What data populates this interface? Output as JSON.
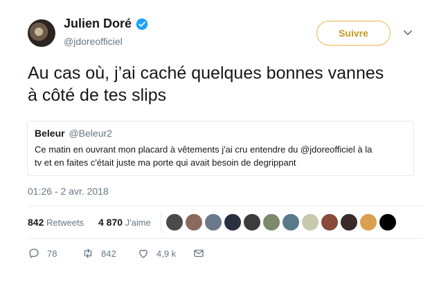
{
  "author": {
    "name": "Julien Doré",
    "handle": "@jdoreofficiel",
    "verified": true
  },
  "follow_button": {
    "label": "Suivre"
  },
  "tweet": {
    "line1": "Au cas où, j’ai caché quelques bonnes vannes",
    "line2": "à côté de tes slips"
  },
  "quoted": {
    "name": "Beleur",
    "handle": "@Beleur2",
    "line1": "Ce matin en ouvrant mon placard à vêtements j'ai cru entendre du @jdoreofficiel à la",
    "line2": "tv et en faites c'était juste ma porte qui avait besoin de degrippant"
  },
  "timestamp": "01:26 - 2 avr. 2018",
  "stats": {
    "retweets_count": "842",
    "retweets_label": "Retweets",
    "likes_count": "4 870",
    "likes_label": "J'aime"
  },
  "likers_colors": [
    "#4a4a4a",
    "#8a6a5a",
    "#6a7a8a",
    "#2a3040",
    "#3c3c3c",
    "#7a8a6a",
    "#5a7a8a",
    "#c9c9b0",
    "#8a4a3a",
    "#3a2a2a",
    "#d9a050",
    "#000000"
  ],
  "actions": {
    "replies": "78",
    "retweets": "842",
    "likes": "4,9 k"
  },
  "colors": {
    "accent": "#e8b64a",
    "verified": "#1da1f2",
    "muted": "#657786"
  }
}
